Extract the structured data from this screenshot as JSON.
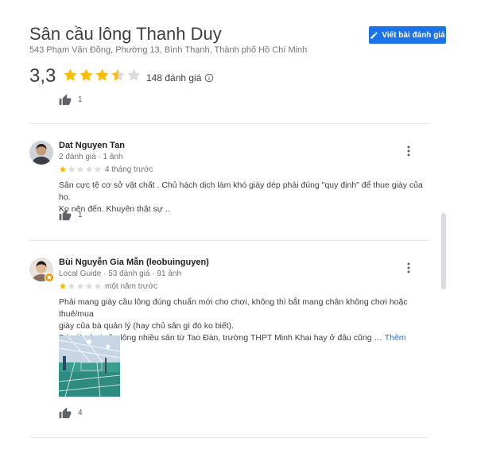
{
  "place": {
    "name": "Sân cầu lông Thanh Duy",
    "address": "543 Phạm Văn Đồng, Phường 13, Bình Thạnh, Thành phố Hồ Chí Minh",
    "rating": "3,3",
    "rating_value": 3.3,
    "review_count": "148 đánh giá",
    "write_review_label": "Viết bài đánh giá"
  },
  "colors": {
    "accent": "#1a73e8",
    "star": "#fbbc04",
    "star_empty": "#dadce0"
  },
  "prev_review": {
    "likes": "1"
  },
  "reviews": [
    {
      "author": "Dat Nguyen Tan",
      "meta": "2 đánh giá · 1 ảnh",
      "stars": 1,
      "when": "4 tháng trước",
      "text_lines": [
        "Sân cực tệ cơ sở vật chất . Chủ hách dịch làm khó giày dép phải đúng \"quy định\" để thue giày của họ.",
        "Ko nên đến. Khuyên thật sự .."
      ],
      "likes": "1"
    },
    {
      "author": "Bùi Nguyễn Gia Mẫn (leobuinguyen)",
      "meta": "Local Guide · 53 đánh giá · 91 ảnh",
      "stars": 1,
      "when": "một năm trước",
      "text_lines": [
        "Phải mang giày cầu lông đúng chuẩn mới cho chơi, không thì bắt mang chân không chơi hoặc thuê/mua",
        "giày của bà quản lý (hay chủ sân gì đó ko biết).",
        "Đó giờ chơi cầu lông nhiều sân từ Tao Đàn, trường THPT Minh Khai hay ở đâu cũng …"
      ],
      "more_label": "Thêm",
      "likes": "4"
    }
  ]
}
